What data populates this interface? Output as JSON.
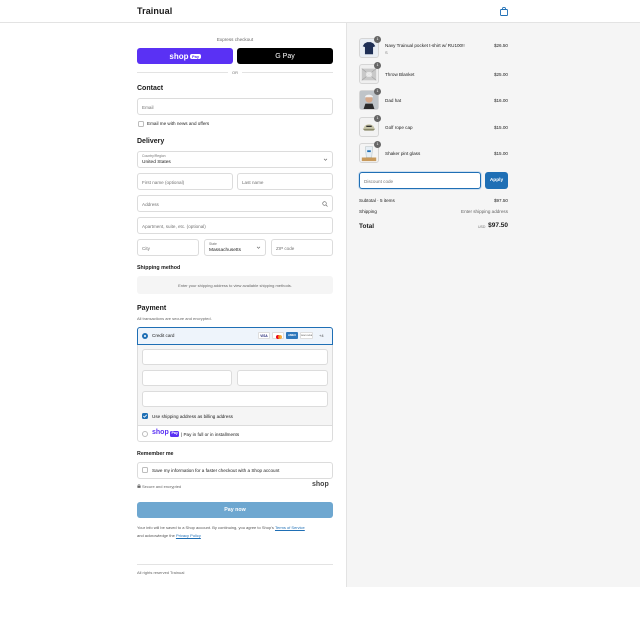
{
  "header": {
    "brand": "Trainual",
    "bag_icon": "shopping-bag-icon"
  },
  "express": {
    "title": "Express checkout",
    "shop_pay_label": "shop",
    "shop_pay_badge": "Pay",
    "gpay_label": "G Pay",
    "or_label": "OR"
  },
  "contact": {
    "title": "Contact",
    "email_placeholder": "Email",
    "news_label": "Email me with news and offers"
  },
  "delivery": {
    "title": "Delivery",
    "country_label": "Country/Region",
    "country_value": "United States",
    "first_name_placeholder": "First name (optional)",
    "last_name_placeholder": "Last name",
    "address_placeholder": "Address",
    "apartment_placeholder": "Apartment, suite, etc. (optional)",
    "city_placeholder": "City",
    "state_label": "State",
    "state_value": "Massachusetts",
    "zip_placeholder": "ZIP code"
  },
  "shipping_method": {
    "title": "Shipping method",
    "note": "Enter your shipping address to view available shipping methods."
  },
  "payment": {
    "title": "Payment",
    "subtitle": "All transactions are secure and encrypted.",
    "credit_card_label": "Credit card",
    "card_brands": [
      "VISA",
      "MC",
      "AMEX",
      "DISCOVER"
    ],
    "more_cards": "+4",
    "billing_label": "Use shipping address as billing address",
    "shop_pay_installments": "| Pay in full or in installments",
    "shop_pay_word": "shop",
    "shop_pay_badge": "Pay"
  },
  "remember_me": {
    "title": "Remember me",
    "save_label": "Save my information for a faster checkout with a Shop account",
    "secure_label": "Secure and encrypted",
    "shop_logo": "shop"
  },
  "pay_now": {
    "label": "Pay now"
  },
  "legal": {
    "text_1": "Your info will be saved to a Shop account. By continuing, you agree to Shop's",
    "terms_link": "Terms of Service",
    "text_2": "and acknowledge the",
    "privacy_link": "Privacy Policy",
    "footer": "All rights reserved Trainual"
  },
  "order": {
    "items": [
      {
        "name": "Navy Trainual pocket t-shirt w/ RU100!!",
        "variant": "S",
        "price": "$26.50",
        "qty": "1"
      },
      {
        "name": "Throw Blanket",
        "variant": "",
        "price": "$25.00",
        "qty": "1"
      },
      {
        "name": "Dad hat",
        "variant": "",
        "price": "$16.00",
        "qty": "1"
      },
      {
        "name": "Golf rope cap",
        "variant": "",
        "price": "$15.00",
        "qty": "1"
      },
      {
        "name": "Shaker pint glass",
        "variant": "",
        "price": "$15.00",
        "qty": "1"
      }
    ],
    "discount_placeholder": "Discount code",
    "apply_label": "Apply",
    "subtotal_label": "Subtotal · 5 items",
    "subtotal_value": "$97.50",
    "shipping_label": "Shipping",
    "shipping_value": "Enter shipping address",
    "total_label": "Total",
    "currency": "USD",
    "total_value": "$97.50"
  },
  "colors": {
    "accent": "#1f6fb5",
    "shop_pay": "#5a31f4",
    "pay_now": "#6ea7d0"
  }
}
